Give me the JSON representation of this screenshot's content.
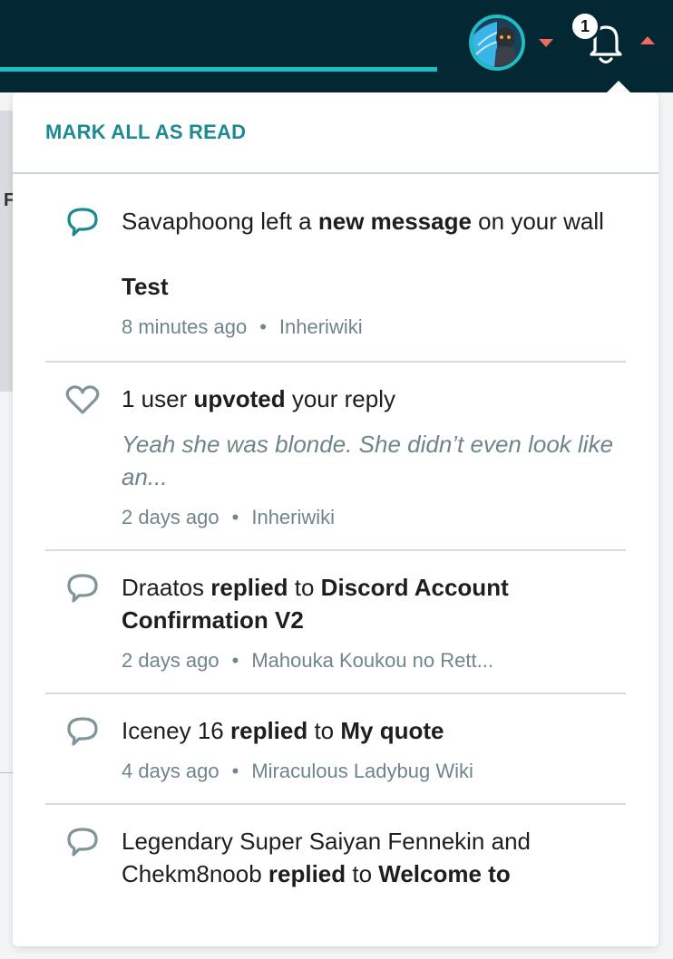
{
  "header": {
    "notification_count": "1",
    "colors": {
      "topbar": "#032834",
      "accent": "#20bcc5",
      "caret": "#f16a5d"
    }
  },
  "panel": {
    "mark_all_read": "MARK ALL AS READ",
    "notifications": [
      {
        "icon": "message-icon",
        "unread": true,
        "actor": "Savaphoong",
        "pre": " left a ",
        "action": "new message",
        "post": " on your wall",
        "title": "Test",
        "time": "8 minutes ago",
        "wiki": "Inheriwiki"
      },
      {
        "icon": "heart-icon",
        "unread": false,
        "actor": "1 user",
        "pre": " ",
        "action": "upvoted",
        "post": " your reply",
        "snippet": "Yeah she was blonde. She didn’t even look like an...",
        "time": "2 days ago",
        "wiki": "Inheriwiki"
      },
      {
        "icon": "message-icon",
        "unread": false,
        "actor": "Draatos",
        "pre": " ",
        "action": "replied",
        "post": " to ",
        "target": "Discord Account Confirmation V2",
        "time": "2 days ago",
        "wiki": "Mahouka Koukou no Rett..."
      },
      {
        "icon": "message-icon",
        "unread": false,
        "actor": "Iceney 16",
        "pre": " ",
        "action": "replied",
        "post": " to ",
        "target": "My quote",
        "time": "4 days ago",
        "wiki": "Miraculous Ladybug Wiki"
      },
      {
        "icon": "message-icon",
        "unread": false,
        "actor": "Legendary Super Saiyan Fennekin and Chekm8noob",
        "pre": " ",
        "action": "replied",
        "post": " to ",
        "target": "Welcome to",
        "time": "",
        "wiki": ""
      }
    ]
  }
}
